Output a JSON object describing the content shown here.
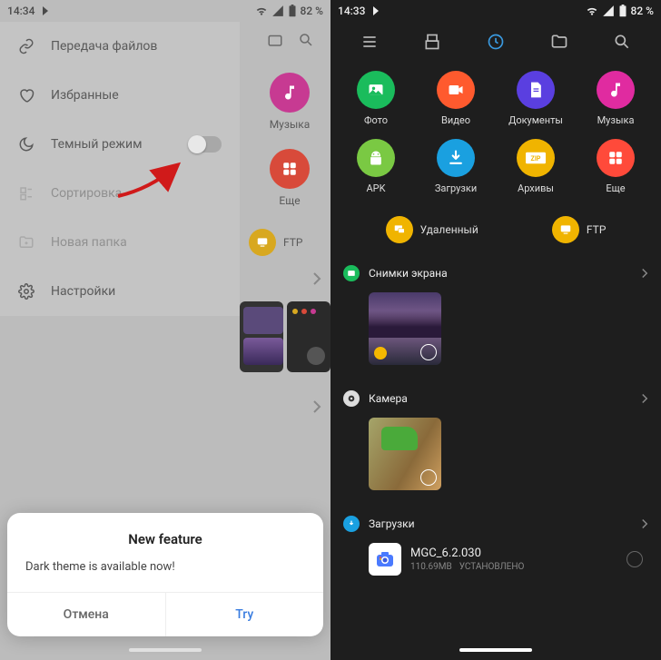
{
  "left": {
    "status": {
      "time": "14:34",
      "battery": "82 %"
    },
    "drawer": {
      "items": [
        {
          "name": "file-transfer",
          "label": "Передача файлов",
          "icon": "link"
        },
        {
          "name": "favorites",
          "label": "Избранные",
          "icon": "heart"
        },
        {
          "name": "dark-mode",
          "label": "Темный режим",
          "icon": "moon",
          "toggle": true
        },
        {
          "name": "sorting",
          "label": "Сортировка",
          "icon": "sort",
          "disabled": true
        },
        {
          "name": "new-folder",
          "label": "Новая папка",
          "icon": "folder-plus",
          "disabled": true
        },
        {
          "name": "settings",
          "label": "Настройки",
          "icon": "gear"
        }
      ]
    },
    "bg_tiles": {
      "music": "Музыка",
      "more": "Еще",
      "ftp": "FTP"
    },
    "sheet": {
      "title": "New feature",
      "message": "Dark theme is available now!",
      "cancel": "Отмена",
      "try": "Try"
    }
  },
  "right": {
    "status": {
      "time": "14:33",
      "battery": "82 %"
    },
    "categories": [
      {
        "label": "Фото",
        "color": "#1abc5c",
        "icon": "photo"
      },
      {
        "label": "Видео",
        "color": "#ff5a2e",
        "icon": "video"
      },
      {
        "label": "Документы",
        "color": "#5a3fe0",
        "icon": "doc"
      },
      {
        "label": "Музыка",
        "color": "#e02ba0",
        "icon": "music"
      },
      {
        "label": "APK",
        "color": "#7ac943",
        "icon": "android"
      },
      {
        "label": "Загрузки",
        "color": "#1aa0e0",
        "icon": "download"
      },
      {
        "label": "Архивы",
        "color": "#f0b400",
        "icon": "zip"
      },
      {
        "label": "Еще",
        "color": "#ff4a3a",
        "icon": "more"
      }
    ],
    "access": {
      "remote": "Удаленный",
      "ftp": "FTP"
    },
    "sections": {
      "screenshots": "Снимки экрана",
      "camera": "Камера",
      "downloads": "Загрузки"
    },
    "file": {
      "name": "MGC_6.2.030",
      "size": "110.69MB",
      "status": "УСТАНОВЛЕНО"
    }
  }
}
